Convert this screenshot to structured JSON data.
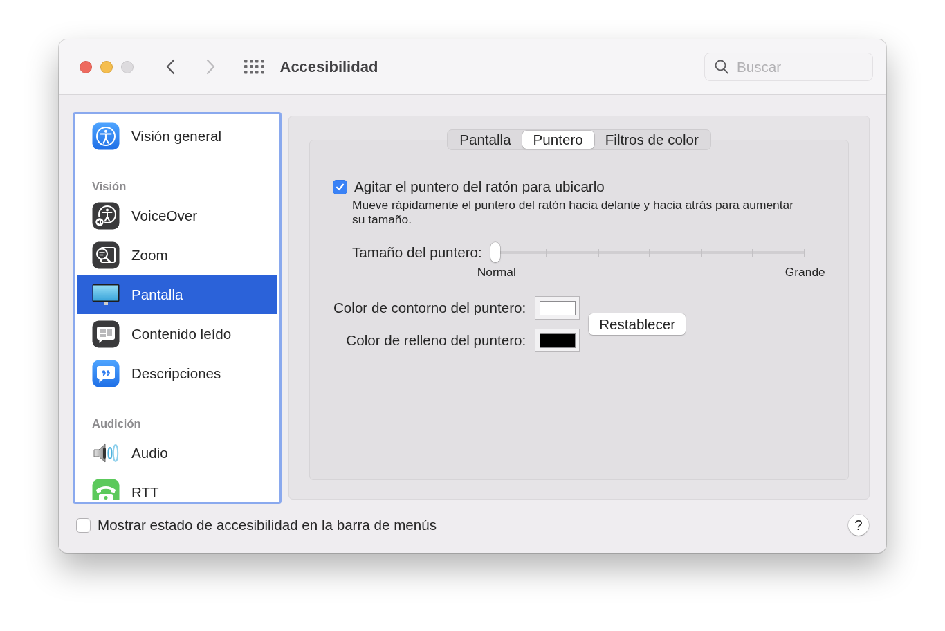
{
  "window": {
    "title": "Accesibilidad",
    "controls": [
      {
        "kind": "close",
        "disabled": false
      },
      {
        "kind": "minimize",
        "disabled": false
      },
      {
        "kind": "zoom",
        "disabled": true
      }
    ],
    "navigation": [
      {
        "kind": "back",
        "disabled": false
      },
      {
        "kind": "forward",
        "disabled": true
      }
    ]
  },
  "search": {
    "placeholder": "Buscar"
  },
  "sidebar": {
    "focused": true,
    "items": [
      {
        "kind": "item",
        "label": "Visión general",
        "selected": false
      },
      {
        "kind": "heading",
        "label": "Visión"
      },
      {
        "kind": "item",
        "label": "VoiceOver",
        "selected": false
      },
      {
        "kind": "item",
        "label": "Zoom",
        "selected": false
      },
      {
        "kind": "item",
        "label": "Pantalla",
        "selected": true
      },
      {
        "kind": "item",
        "label": "Contenido leído",
        "selected": false
      },
      {
        "kind": "item",
        "label": "Descripciones",
        "selected": false
      },
      {
        "kind": "heading",
        "label": "Audición"
      },
      {
        "kind": "item",
        "label": "Audio",
        "selected": false
      },
      {
        "kind": "item",
        "label": "RTT",
        "selected": false
      }
    ]
  },
  "tabs": [
    {
      "label": "Pantalla",
      "selected": false
    },
    {
      "label": "Puntero",
      "selected": true
    },
    {
      "label": "Filtros de color",
      "selected": false
    }
  ],
  "shake_to_locate": {
    "label": "Agitar el puntero del ratón para ubicarlo",
    "checked": true,
    "description": "Mueve rápidamente el puntero del ratón hacia delante y hacia atrás para aumentar su tamaño."
  },
  "pointer_size": {
    "label": "Tamaño del puntero:",
    "level": 0,
    "min_label": "Normal",
    "max_label": "Grande"
  },
  "pointer_colors": [
    {
      "label": "Color de contorno del puntero:",
      "color": "#ffffff"
    },
    {
      "label": "Color de relleno del puntero:",
      "color": "#000000"
    }
  ],
  "reset_button": "Restablecer",
  "footer": {
    "show_in_menu_bar": {
      "label": "Mostrar estado de accesibilidad en la barra de menús",
      "checked": false
    },
    "help_button": "?"
  }
}
